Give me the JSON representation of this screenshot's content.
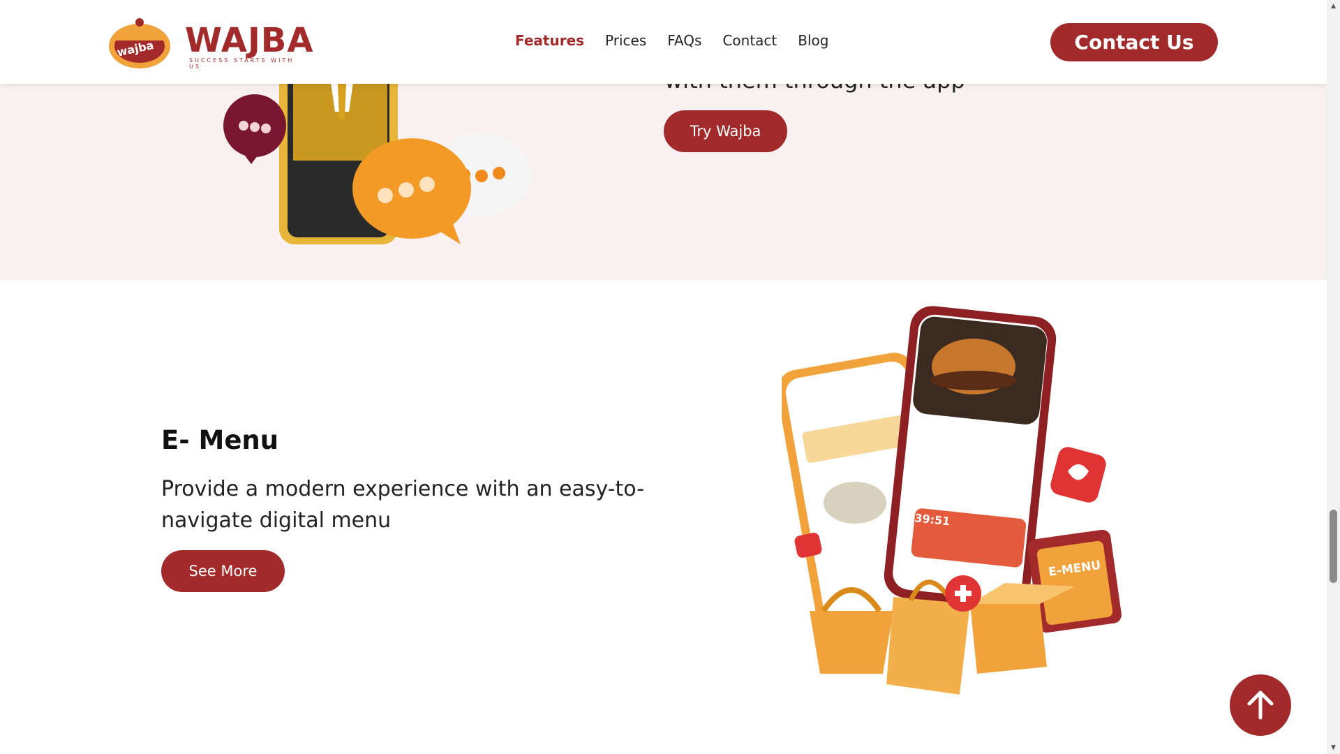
{
  "header": {
    "brand": "WAJBA",
    "tagline": "SUCCESS STARTS WITH US",
    "logo_badge": "wajba",
    "nav": [
      {
        "label": "Features",
        "active": true
      },
      {
        "label": "Prices",
        "active": false
      },
      {
        "label": "FAQs",
        "active": false
      },
      {
        "label": "Contact",
        "active": false
      },
      {
        "label": "Blog",
        "active": false
      }
    ],
    "cta": "Contact Us"
  },
  "section_top": {
    "partial_text": "with them through the app",
    "button": "Try Wajba"
  },
  "e_menu": {
    "title": "E- Menu",
    "description": "Provide a modern experience with an easy-to-navigate digital menu",
    "button": "See More",
    "illustration_badge": "E-MENU",
    "phone_timer": "39:51"
  },
  "colors": {
    "brand": "#a32a2a",
    "accent_orange": "#f2a23a",
    "section_bg": "#f9f1f1"
  },
  "icons": {
    "scroll_top": "arrow-up-icon"
  }
}
